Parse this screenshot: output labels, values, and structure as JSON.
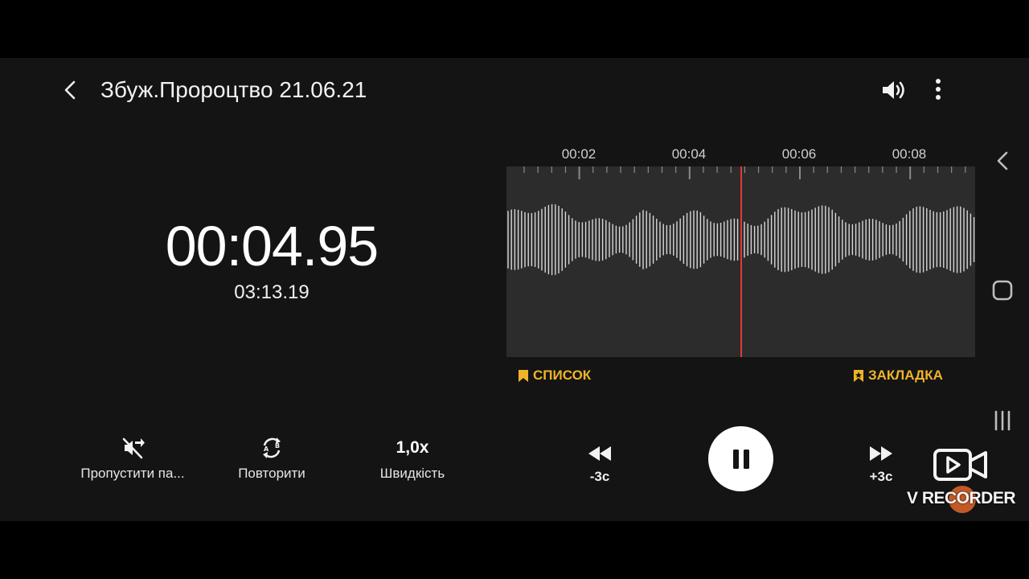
{
  "header": {
    "title": "Збуж.Пророцтво 21.06.21",
    "back_icon": "chevron-left-icon",
    "volume_icon": "volume-icon",
    "more_icon": "more-vertical-icon"
  },
  "player": {
    "current_time": "00:04.95",
    "total_time": "03:13.19"
  },
  "timeline": {
    "tick_labels": [
      "00:02",
      "00:04",
      "00:06",
      "00:08"
    ],
    "playhead_color": "#e53935",
    "wave_color": "#d8d8d8",
    "panel_color": "#2c2c2c"
  },
  "links": {
    "list_label": "СПИСОК",
    "bookmark_label": "ЗАКЛАДКА",
    "accent": "#f0b429"
  },
  "controls": {
    "skip_label": "Пропустити па...",
    "repeat_label": "Повторити",
    "speed_value": "1,0x",
    "speed_label": "Швидкість",
    "rewind_label": "-3с",
    "forward_label": "+3с",
    "play_state_icon": "pause-icon"
  },
  "nav": {
    "back_icon": "chevron-left-icon",
    "home_icon": "rounded-square-icon",
    "recents_icon": "three-lines-icon"
  },
  "watermark": {
    "text": "V RECORDER",
    "icon": "video-camera-icon"
  }
}
